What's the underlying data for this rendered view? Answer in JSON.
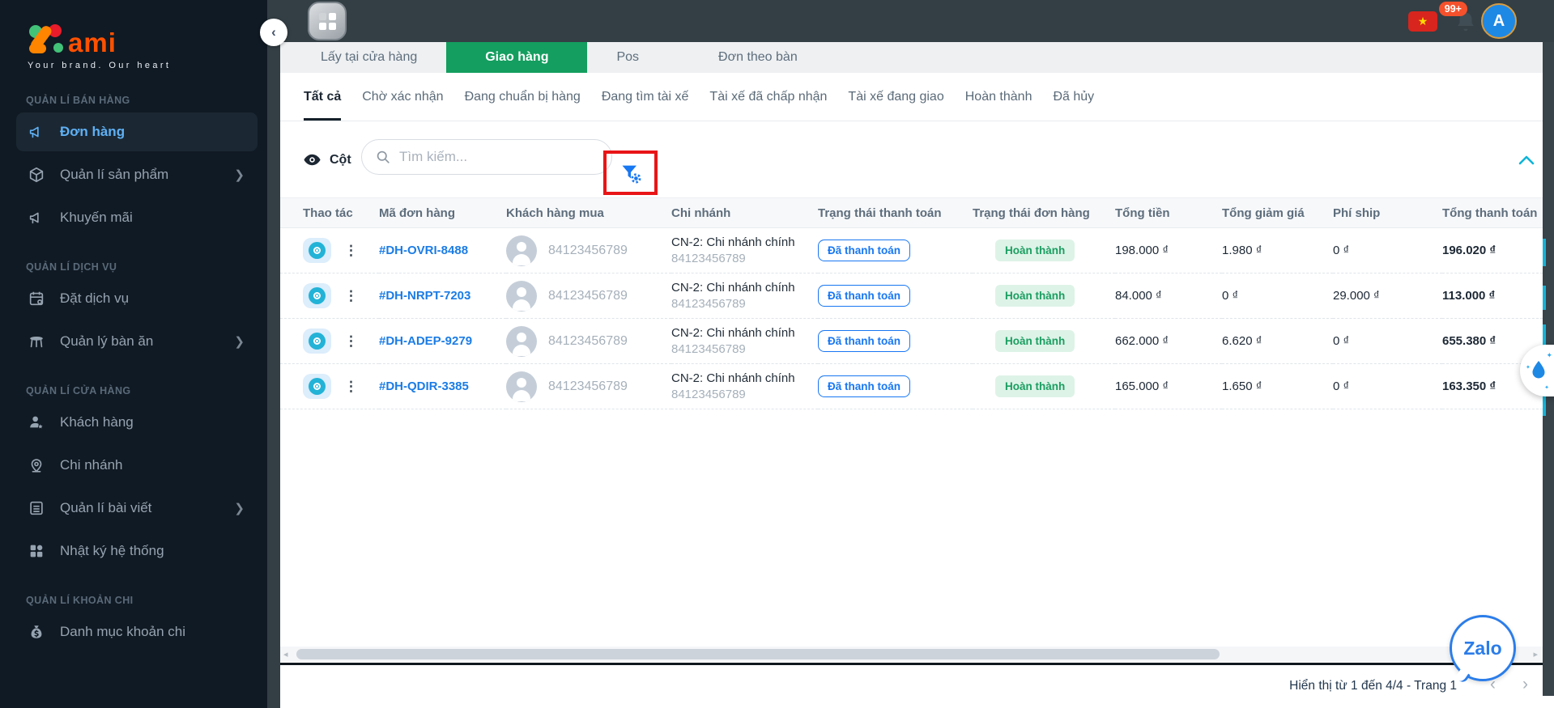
{
  "colors": {
    "accent_green": "#149e5f",
    "accent_blue": "#1877f2",
    "accent_cyan": "#14b4d6",
    "status_green": "#1a9e61",
    "annotation_red": "#e81517",
    "sidebar_bg": "#101a24",
    "topbar_bg": "#333f45"
  },
  "sidebar": {
    "logo_z": "Z",
    "logo_text": "ami",
    "tagline": "Your brand. Our heart",
    "sections": [
      {
        "label": "QUẢN LÍ BÁN HÀNG",
        "items": [
          {
            "label": "Đơn hàng",
            "icon": "megaphone-icon",
            "active": true
          },
          {
            "label": "Quản lí sản phẩm",
            "icon": "cube-icon",
            "chevron": "❯"
          },
          {
            "label": "Khuyến mãi",
            "icon": "megaphone-icon"
          }
        ]
      },
      {
        "label": "QUẢN LÍ DỊCH VỤ",
        "items": [
          {
            "label": "Đặt dịch vụ",
            "icon": "calendar-icon"
          },
          {
            "label": "Quản lý bàn ăn",
            "icon": "table-icon",
            "chevron": "❯"
          }
        ]
      },
      {
        "label": "QUẢN LÍ CỬA HÀNG",
        "items": [
          {
            "label": "Khách hàng",
            "icon": "person-star-icon"
          },
          {
            "label": "Chi nhánh",
            "icon": "map-pin-icon"
          },
          {
            "label": "Quản lí bài viết",
            "icon": "document-icon",
            "chevron": "❯"
          },
          {
            "label": "Nhật ký hệ thống",
            "icon": "grid-icon"
          }
        ]
      },
      {
        "label": "QUẢN LÍ KHOẢN CHI",
        "items": [
          {
            "label": "Danh mục khoản chi",
            "icon": "money-bag-icon"
          }
        ]
      }
    ]
  },
  "topbar": {
    "notification_badge": "99+",
    "avatar_initial": "A"
  },
  "main_tabs": [
    {
      "label": "Lấy tại cửa hàng"
    },
    {
      "label": "Giao hàng",
      "active": true
    },
    {
      "label": "Pos"
    },
    {
      "label": "Đơn theo bàn"
    }
  ],
  "status_tabs": [
    {
      "label": "Tất cả",
      "active": true
    },
    {
      "label": "Chờ xác nhận"
    },
    {
      "label": "Đang chuẩn bị hàng"
    },
    {
      "label": "Đang tìm tài xế"
    },
    {
      "label": "Tài xế đã chấp nhận"
    },
    {
      "label": "Tài xế đang giao"
    },
    {
      "label": "Hoàn thành"
    },
    {
      "label": "Đã hủy"
    }
  ],
  "toolbar": {
    "columns_label": "Cột",
    "search_placeholder": "Tìm kiếm..."
  },
  "table": {
    "headers": [
      "Thao tác",
      "Mã đơn hàng",
      "Khách hàng mua",
      "Chi nhánh",
      "Trạng thái thanh toán",
      "Trạng thái đơn hàng",
      "Tổng tiền",
      "Tổng giảm giá",
      "Phí ship",
      "Tổng thanh toán"
    ],
    "rows": [
      {
        "code": "#DH-OVRI-8488",
        "phone": "84123456789",
        "branch1": "CN-2: Chi nhánh chính",
        "branch2": "84123456789",
        "payment": "Đã thanh toán",
        "status": "Hoàn thành",
        "total": "198.000 ₫",
        "discount": "1.980 ₫",
        "ship": "0 ₫",
        "final": "196.020 ₫"
      },
      {
        "code": "#DH-NRPT-7203",
        "phone": "84123456789",
        "branch1": "CN-2: Chi nhánh chính",
        "branch2": "84123456789",
        "payment": "Đã thanh toán",
        "status": "Hoàn thành",
        "total": "84.000 ₫",
        "discount": "0 ₫",
        "ship": "29.000 ₫",
        "final": "113.000 ₫"
      },
      {
        "code": "#DH-ADEP-9279",
        "phone": "84123456789",
        "branch1": "CN-2: Chi nhánh chính",
        "branch2": "84123456789",
        "payment": "Đã thanh toán",
        "status": "Hoàn thành",
        "total": "662.000 ₫",
        "discount": "6.620 ₫",
        "ship": "0 ₫",
        "final": "655.380 ₫"
      },
      {
        "code": "#DH-QDIR-3385",
        "phone": "84123456789",
        "branch1": "CN-2: Chi nhánh chính",
        "branch2": "84123456789",
        "payment": "Đã thanh toán",
        "status": "Hoàn thành",
        "total": "165.000 ₫",
        "discount": "1.650 ₫",
        "ship": "0 ₫",
        "final": "163.350 ₫"
      }
    ]
  },
  "pagination": {
    "text": "Hiển thị từ 1 đến 4/4 - Trang 1"
  },
  "zalo_label": "Zalo"
}
